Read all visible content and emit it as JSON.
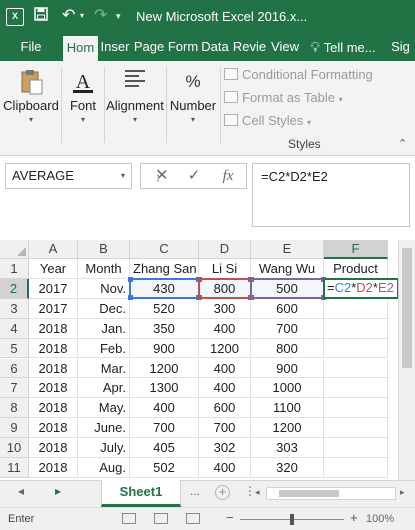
{
  "title_bar": {
    "title": "New Microsoft Excel 2016.x...",
    "icons": [
      "excel-app-icon",
      "save-icon",
      "undo-icon",
      "redo-icon",
      "customize-qat-icon"
    ]
  },
  "ribbon_tabs": [
    "File",
    "Hom",
    "Inser",
    "Page",
    "Form",
    "Data",
    "Revie",
    "View",
    "Tell me...",
    "Sig"
  ],
  "active_tab": "Hom",
  "ribbon": {
    "clipboard": "Clipboard",
    "font": "Font",
    "alignment": "Alignment",
    "number": "Number",
    "percent_symbol": "%",
    "styles_items": [
      "Conditional Formatting",
      "Format as Table",
      "Cell Styles"
    ],
    "styles_group": "Styles"
  },
  "formula_bar": {
    "name_box": "AVERAGE",
    "cancel": "✕",
    "enter": "✓",
    "fx": "fx",
    "formula": "=C2*D2*E2"
  },
  "columns": [
    "A",
    "B",
    "C",
    "D",
    "E",
    "F"
  ],
  "selected_column": "F",
  "rows": [
    "1",
    "2",
    "3",
    "4",
    "5",
    "6",
    "7",
    "8",
    "9",
    "10",
    "11"
  ],
  "selected_row": "2",
  "table": {
    "headers": [
      "Year",
      "Month",
      "Zhang San",
      "Li Si",
      "Wang Wu",
      "Product"
    ],
    "data": [
      [
        "2017",
        "Nov.",
        "430",
        "800",
        "500"
      ],
      [
        "2017",
        "Dec.",
        "520",
        "300",
        "600"
      ],
      [
        "2018",
        "Jan.",
        "350",
        "400",
        "700"
      ],
      [
        "2018",
        "Feb.",
        "900",
        "1200",
        "800"
      ],
      [
        "2018",
        "Mar.",
        "1200",
        "400",
        "900"
      ],
      [
        "2018",
        "Apr.",
        "1300",
        "400",
        "1000"
      ],
      [
        "2018",
        "May.",
        "400",
        "600",
        "1100"
      ],
      [
        "2018",
        "June.",
        "700",
        "700",
        "1200"
      ],
      [
        "2018",
        "July.",
        "405",
        "302",
        "303"
      ],
      [
        "2018",
        "Aug.",
        "502",
        "400",
        "320"
      ]
    ]
  },
  "active_cell_formula": {
    "eq": "=",
    "ref1": "C2",
    "op1": "*",
    "ref2": "D2",
    "op2": "*",
    "ref3": "E2"
  },
  "ref_colors": {
    "C2": "#3c78d8",
    "D2": "#c0504d",
    "E2": "#8064a2"
  },
  "sheet_tabs": {
    "active": "Sheet1",
    "more": "...",
    "add": "+"
  },
  "status_bar": {
    "mode": "Enter",
    "zoom": "100%",
    "zoom_minus": "−",
    "zoom_plus": "+"
  },
  "accent_color": "#217346"
}
